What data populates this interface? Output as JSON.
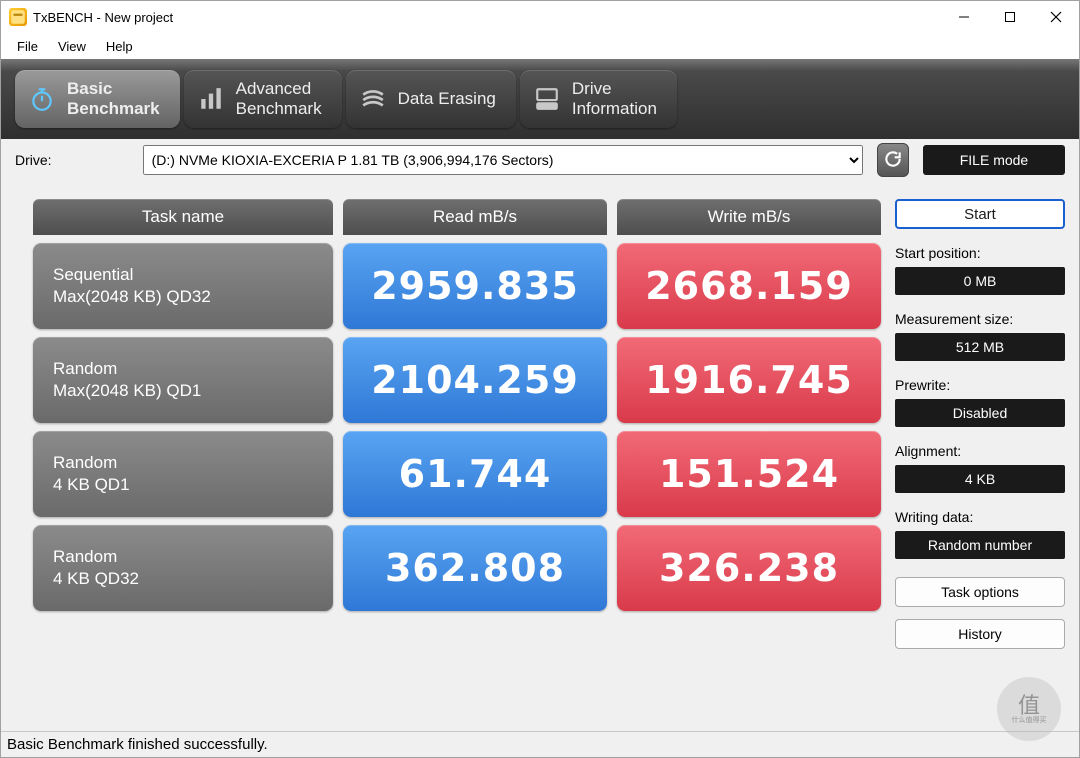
{
  "window": {
    "title": "TxBENCH - New project"
  },
  "menu": {
    "file": "File",
    "view": "View",
    "help": "Help"
  },
  "nav": {
    "basic1": "Basic",
    "basic2": "Benchmark",
    "adv1": "Advanced",
    "adv2": "Benchmark",
    "erase": "Data Erasing",
    "drive1": "Drive",
    "drive2": "Information"
  },
  "driveRow": {
    "label": "Drive:",
    "selected": "(D:) NVMe KIOXIA-EXCERIA P  1.81 TB (3,906,994,176 Sectors)",
    "fileMode": "FILE mode"
  },
  "headers": {
    "task": "Task name",
    "read": "Read mB/s",
    "write": "Write mB/s"
  },
  "rows": [
    {
      "t1": "Sequential",
      "t2": "Max(2048 KB) QD32",
      "read": "2959.835",
      "write": "2668.159"
    },
    {
      "t1": "Random",
      "t2": "Max(2048 KB) QD1",
      "read": "2104.259",
      "write": "1916.745"
    },
    {
      "t1": "Random",
      "t2": "4 KB QD1",
      "read": "61.744",
      "write": "151.524"
    },
    {
      "t1": "Random",
      "t2": "4 KB QD32",
      "read": "362.808",
      "write": "326.238"
    }
  ],
  "side": {
    "start": "Start",
    "startPosLabel": "Start position:",
    "startPosVal": "0 MB",
    "measLabel": "Measurement size:",
    "measVal": "512 MB",
    "prewriteLabel": "Prewrite:",
    "prewriteVal": "Disabled",
    "alignLabel": "Alignment:",
    "alignVal": "4 KB",
    "writingLabel": "Writing data:",
    "writingVal": "Random number",
    "taskOptions": "Task options",
    "history": "History"
  },
  "status": "Basic Benchmark finished successfully.",
  "watermark": {
    "top": "值",
    "bottom": "什么值得买"
  }
}
